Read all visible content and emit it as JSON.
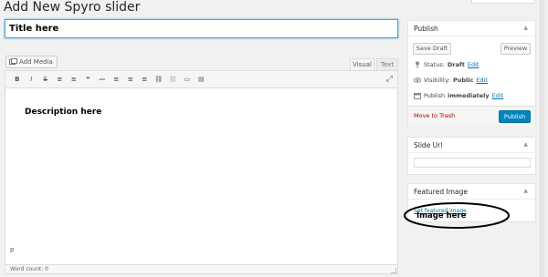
{
  "header": {
    "title": "Add New Spyro slider"
  },
  "post": {
    "title_value": "Title here"
  },
  "editor": {
    "add_media_label": "Add Media",
    "tab_visual": "Visual",
    "tab_text": "Text",
    "toolbar_icons": [
      "bold-icon",
      "italic-icon",
      "strikethrough-icon",
      "bullet-list-icon",
      "numbered-list-icon",
      "blockquote-icon",
      "horizontal-rule-icon",
      "align-left-icon",
      "align-center-icon",
      "align-right-icon",
      "insert-link-icon",
      "remove-link-icon",
      "read-more-icon",
      "toolbar-toggle-icon"
    ],
    "toolbar_glyphs": [
      "B",
      "I",
      "S",
      "≡",
      "≡",
      "❝",
      "—",
      "≡",
      "≡",
      "≡",
      "⛓",
      "⛓",
      "▭",
      "▤"
    ],
    "body_text": "Description here",
    "path": "p",
    "word_count": "Word count: 0"
  },
  "publish": {
    "title": "Publish",
    "save_draft": "Save Draft",
    "preview": "Preview",
    "status_label": "Status:",
    "status_value": "Draft",
    "edit": "Edit",
    "visibility_label": "Visibility:",
    "visibility_value": "Public",
    "publish_label": "Publish",
    "publish_value": "immediately",
    "trash": "Move to Trash",
    "publish_button": "Publish"
  },
  "slide_url": {
    "title": "Slide Url"
  },
  "featured": {
    "title": "Featured Image",
    "link": "Set featured image",
    "annotation": "Image here"
  },
  "colors": {
    "link": "#0073aa",
    "primary_button": "#0085ba",
    "trash": "#a00000",
    "focus": "#5b9dd9"
  }
}
